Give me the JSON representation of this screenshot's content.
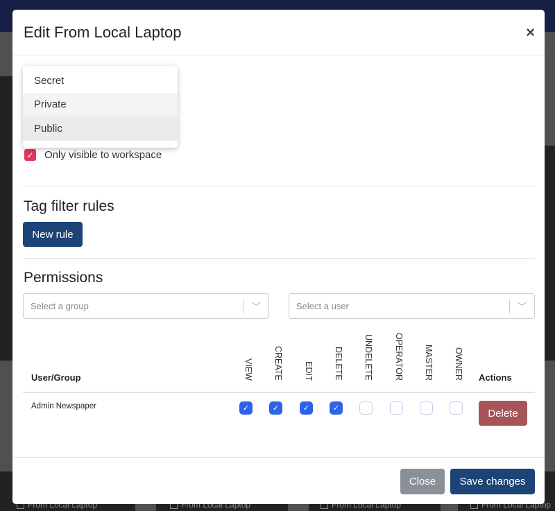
{
  "modal": {
    "title": "Edit From Local Laptop",
    "close_icon": "×"
  },
  "visibility_dropdown": {
    "options": [
      "Secret",
      "Private",
      "Public"
    ],
    "highlighted": "Public"
  },
  "workspace_checkbox": {
    "label": "Only visible to workspace",
    "checked": true
  },
  "tag_filter": {
    "heading": "Tag filter rules",
    "new_rule_label": "New rule"
  },
  "permissions": {
    "heading": "Permissions",
    "group_placeholder": "Select a group",
    "user_placeholder": "Select a user",
    "columns": {
      "user_group": "User/Group",
      "perms": [
        "VIEW",
        "CREATE",
        "EDIT",
        "DELETE",
        "UNDELETE",
        "OPERATOR",
        "MASTER",
        "OWNER"
      ],
      "actions": "Actions"
    },
    "rows": [
      {
        "name": "Admin Newspaper",
        "values": [
          true,
          true,
          true,
          true,
          false,
          false,
          false,
          false
        ],
        "delete_label": "Delete"
      }
    ]
  },
  "footer": {
    "close_label": "Close",
    "save_label": "Save changes"
  },
  "background": {
    "card_label": "From Local Laptop"
  },
  "colors": {
    "primary": "#1c4476",
    "danger": "#a6545a",
    "secondary": "#8a9097",
    "checkbox": "#2c63e8",
    "accent": "#e0365f"
  }
}
